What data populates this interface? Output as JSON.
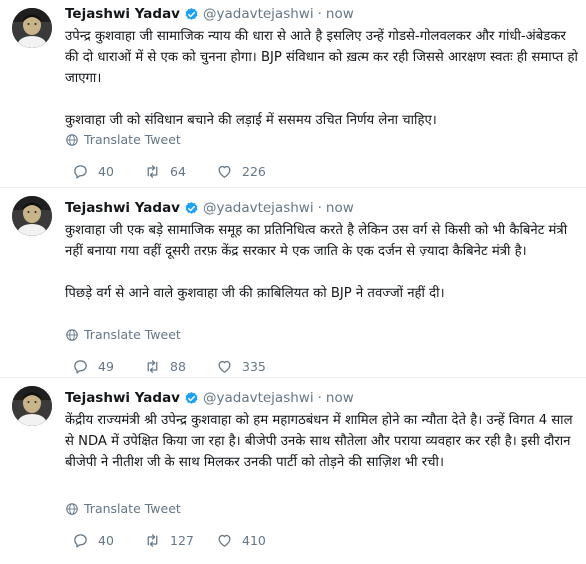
{
  "tweets": [
    {
      "name": "Tejashwi Yadav",
      "handle": "@yadavtejashwi",
      "separator": "·",
      "time": "now",
      "paragraphs": [
        "उपेन्द्र कुशवाहा जी सामाजिक न्याय की धारा से आते है इसलिए उन्हें गोडसे-गोलवलकर और गांधी-अंबेडकर की दो धाराओं में से एक को चुनना होगा। BJP संविधान को ख़त्म कर रही जिससे आरक्षण स्वतः ही समाप्त हो जाएगा।",
        "कुशवाहा जी को संविधान बचाने की लड़ाई में ससमय उचित निर्णय लेना चाहिए।"
      ],
      "translate": "Translate Tweet",
      "replies": "40",
      "retweets": "64",
      "likes": "226"
    },
    {
      "name": "Tejashwi Yadav",
      "handle": "@yadavtejashwi",
      "separator": "·",
      "time": "now",
      "paragraphs": [
        "कुशवाहा जी एक बड़े सामाजिक समूह का प्रतिनिधित्व करते है लेकिन उस वर्ग से किसी को भी कैबिनेट मंत्री नहीं बनाया गया वहीं दूसरी तरफ़ केंद्र सरकार मे एक जाति के एक दर्जन से ज़्यादा कैबिनेट मंत्री है।",
        "पिछड़े वर्ग से आने वाले कुशवाहा जी की क़ाबिलियत को BJP ने तवज्जों नहीं दी।"
      ],
      "translate": "Translate Tweet",
      "replies": "49",
      "retweets": "88",
      "likes": "335"
    },
    {
      "name": "Tejashwi Yadav",
      "handle": "@yadavtejashwi",
      "separator": "·",
      "time": "now",
      "paragraphs": [
        "केंद्रीय राज्यमंत्री श्री उपेन्द्र कुशवाहा को हम महागठबंधन में शामिल होने का न्यौता देते है। उन्हें विगत 4 साल से NDA में उपेक्षित किया जा रहा है। बीजेपी उनके साथ सौतेला और पराया व्यवहार कर रही है। इसी दौरान बीजेपी ने नीतीश जी के साथ मिलकर उनकी पार्टी को तोड़ने की साज़िश भी रची।"
      ],
      "translate": "Translate Tweet",
      "replies": "40",
      "retweets": "127",
      "likes": "410"
    }
  ],
  "colors": {
    "text": "#14171a",
    "muted": "#657786",
    "verified": "#1da1f2",
    "divider": "#e6ecf0"
  },
  "icons": {
    "verified": "verified-badge-icon",
    "translate": "globe-icon",
    "reply": "reply-icon",
    "retweet": "retweet-icon",
    "like": "heart-icon"
  }
}
